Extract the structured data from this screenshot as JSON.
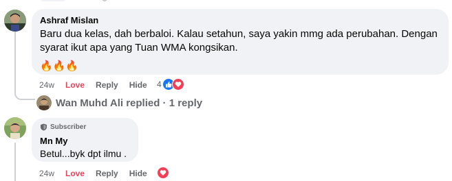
{
  "comment1": {
    "author": "Ashraf Mislan",
    "text": "Baru dua kelas, dah berbaloi. Kalau setahun, saya yakin mmg ada perubahan. Dengan syarat ikut apa yang Tuan WMA kongsikan.",
    "emoji": "🔥🔥🔥",
    "time": "24w",
    "love": "Love",
    "reply": "Reply",
    "hide": "Hide",
    "reaction_count": "4"
  },
  "replies_link": {
    "text": "Wan Muhd Ali replied · 1 reply"
  },
  "comment2": {
    "badge": "Subscriber",
    "author": "Mn My",
    "text": "Betul...byk dpt ilmu .",
    "time": "24w",
    "love": "Love",
    "reply": "Reply",
    "hide": "Hide"
  },
  "colors": {
    "bubble": "#f0f2f5",
    "love": "#f33e58",
    "like": "#1877f2",
    "meta": "#65676b"
  }
}
